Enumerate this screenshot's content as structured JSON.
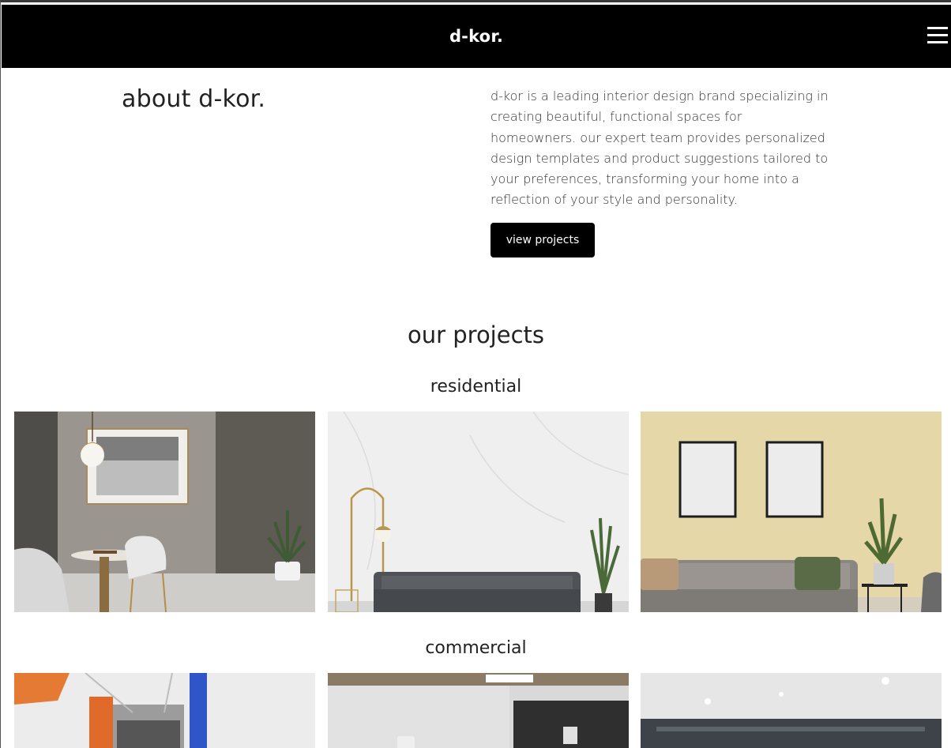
{
  "navbar": {
    "brand": "d-kor.",
    "menu_icon": "hamburger-menu-icon"
  },
  "about": {
    "title": "about d-kor.",
    "description": "d-kor is a leading interior design brand specializing in creating beautiful, functional spaces for homeowners. our expert team provides personalized design templates and product suggestions tailored to your preferences, transforming your home into a reflection of your style and personality.",
    "button_label": "view projects"
  },
  "projects": {
    "title": "our projects",
    "categories": [
      {
        "name": "residential",
        "images": [
          "dining-room-with-pendant-lamp",
          "living-room-marble-wall-grey-sofa",
          "living-room-beige-wall-frames"
        ]
      },
      {
        "name": "commercial",
        "images": [
          "office-corridor-orange-blue",
          "office-reception-dark-wall",
          "open-plan-office-ceiling"
        ]
      }
    ]
  },
  "colors": {
    "navbar_bg": "#000000",
    "button_bg": "#000000",
    "text": "#222222"
  }
}
